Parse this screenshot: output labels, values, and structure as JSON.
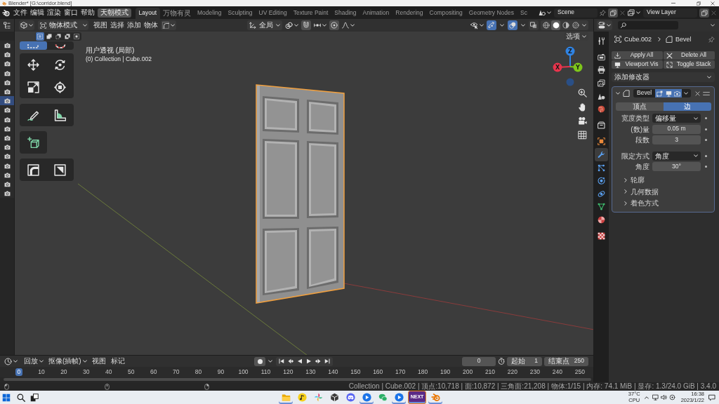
{
  "window": {
    "title": "Blender* [G:\\corridor.blend]"
  },
  "topbar": {
    "menus": [
      "文件",
      "编辑",
      "渲染",
      "窗口",
      "帮助"
    ],
    "mode_button": "天朝模式",
    "workspaces": [
      {
        "label": "Layout",
        "selected": true
      },
      {
        "label": "万物有灵",
        "selected": false
      },
      {
        "label": "Modeling",
        "selected": false
      },
      {
        "label": "Sculpting",
        "selected": false
      },
      {
        "label": "UV Editing",
        "selected": false
      },
      {
        "label": "Texture Paint",
        "selected": false
      },
      {
        "label": "Shading",
        "selected": false
      },
      {
        "label": "Animation",
        "selected": false
      },
      {
        "label": "Rendering",
        "selected": false
      },
      {
        "label": "Compositing",
        "selected": false
      },
      {
        "label": "Geometry Nodes",
        "selected": false
      },
      {
        "label": "Sc",
        "selected": false
      }
    ],
    "scene": "Scene",
    "view_layer": "View Layer"
  },
  "outliner": {
    "rows": [
      {
        "selected": false
      },
      {
        "selected": false
      },
      {
        "selected": false
      },
      {
        "selected": false
      },
      {
        "selected": false
      },
      {
        "selected": false
      },
      {
        "selected": true
      },
      {
        "selected": false
      },
      {
        "selected": false
      },
      {
        "selected": false
      },
      {
        "selected": false
      },
      {
        "selected": false
      },
      {
        "selected": false
      },
      {
        "selected": false
      },
      {
        "selected": false
      },
      {
        "selected": false
      },
      {
        "selected": false
      }
    ]
  },
  "viewport": {
    "mode": "物体模式",
    "menus": [
      "视图",
      "选择",
      "添加",
      "物体"
    ],
    "orientation": "全局",
    "toggles": [
      {
        "kind": "gizmo",
        "on": true
      },
      {
        "kind": "overlay",
        "on": true
      },
      {
        "kind": "xray",
        "on": false
      }
    ],
    "shading": [
      {
        "kind": "wireframe",
        "selected": false
      },
      {
        "kind": "solid",
        "selected": true
      },
      {
        "kind": "material",
        "selected": false
      },
      {
        "kind": "rendered",
        "selected": false
      }
    ],
    "options": "选项",
    "select_modes": [
      {
        "kind": "set",
        "selected": true
      },
      {
        "kind": "extend",
        "selected": false
      },
      {
        "kind": "subtract",
        "selected": false
      },
      {
        "kind": "difference",
        "selected": false
      },
      {
        "kind": "intersect",
        "selected": false
      }
    ],
    "tool_groups": [
      {
        "tools": [
          {
            "kind": "select",
            "selected": true
          },
          {
            "kind": "cursor",
            "selected": false
          }
        ]
      },
      {
        "tools": [
          {
            "kind": "move",
            "selected": false
          },
          {
            "kind": "rotate",
            "selected": false
          },
          {
            "kind": "scale",
            "selected": false
          },
          {
            "kind": "transform",
            "selected": false
          }
        ]
      },
      {
        "tools": [
          {
            "kind": "annotate",
            "selected": false
          },
          {
            "kind": "measure",
            "selected": false
          }
        ]
      },
      {
        "tools": [
          {
            "kind": "add_cube",
            "selected": false
          }
        ]
      },
      {
        "tools": [
          {
            "kind": "fillet",
            "selected": false
          },
          {
            "kind": "shear",
            "selected": false
          }
        ]
      }
    ],
    "view_name": "用户透视 (局部)",
    "info": "(0) Collection | Cube.002",
    "axes": [
      {
        "kind": "positive",
        "label": "Z",
        "color": "#2f83e3"
      },
      {
        "kind": "positive",
        "label": "X",
        "color": "#e8344c"
      },
      {
        "kind": "positive",
        "label": "Y",
        "color": "#7ec61b"
      },
      {
        "kind": "negative",
        "color": "#2a4f86"
      }
    ]
  },
  "properties": {
    "tab_groups": [
      {
        "tabs": [
          {
            "kind": "tool",
            "selected": false
          }
        ]
      },
      {
        "tabs": [
          {
            "kind": "render",
            "selected": false
          },
          {
            "kind": "output",
            "selected": false
          },
          {
            "kind": "view_layer",
            "selected": false
          },
          {
            "kind": "scene",
            "selected": false
          },
          {
            "kind": "world",
            "selected": false
          }
        ]
      },
      {
        "tabs": [
          {
            "kind": "collection",
            "selected": false
          }
        ]
      },
      {
        "tabs": [
          {
            "kind": "object",
            "selected": false
          },
          {
            "kind": "modifier",
            "selected": true
          },
          {
            "kind": "particles",
            "selected": false
          },
          {
            "kind": "physics",
            "selected": false
          },
          {
            "kind": "constraints",
            "selected": false
          },
          {
            "kind": "data",
            "selected": false
          },
          {
            "kind": "material",
            "selected": false
          }
        ]
      },
      {
        "tabs": [
          {
            "kind": "texture",
            "selected": false
          }
        ]
      }
    ],
    "breadcrumb": [
      {
        "kind": "object",
        "label": "Cube.002"
      },
      {
        "kind": "modifier",
        "label": "Bevel"
      }
    ],
    "actions": [
      {
        "kind": "apply",
        "label": "Apply All"
      },
      {
        "kind": "delete",
        "label": "Delete All"
      },
      {
        "kind": "visibility",
        "label": "Viewport Vis"
      },
      {
        "kind": "stack",
        "label": "Toggle Stack"
      }
    ],
    "add_modifier": "添加修改器",
    "modifier": {
      "name": "Bevel",
      "expanded": true,
      "toggles": [
        {
          "kind": "edit_mode",
          "on": true
        },
        {
          "kind": "viewport",
          "on": true
        },
        {
          "kind": "render",
          "on": true
        }
      ],
      "affect": [
        {
          "label": "顶点",
          "selected": false
        },
        {
          "label": "边",
          "selected": true
        }
      ],
      "field_groups": [
        {
          "fields": [
            {
              "kind": "dropdown",
              "label": "宽度类型",
              "value": "偏移量"
            },
            {
              "kind": "number",
              "label": "(数)量",
              "value": "0.05 m"
            },
            {
              "kind": "number",
              "label": "段数",
              "value": "3"
            }
          ]
        },
        {
          "fields": [
            {
              "kind": "dropdown",
              "label": "限定方式",
              "value": "角度"
            },
            {
              "kind": "number",
              "label": "角度",
              "value": "30°"
            }
          ]
        }
      ],
      "subpanels": [
        {
          "label": "轮廓",
          "expanded": false
        },
        {
          "label": "几何数据",
          "expanded": false
        },
        {
          "label": "着色方式",
          "expanded": false
        }
      ]
    }
  },
  "timeline": {
    "menus": [
      {
        "kind": "dropdown",
        "label": "回放"
      },
      {
        "kind": "dropdown",
        "label": "抠像(插帧)"
      },
      {
        "kind": "plain",
        "label": "视图"
      },
      {
        "kind": "plain",
        "label": "标记"
      }
    ],
    "frame": "0",
    "start_label": "起始",
    "start": "1",
    "end_label": "结束点",
    "end": "250",
    "ruler": [
      {
        "label": "0",
        "current": true
      },
      {
        "label": "10",
        "current": false
      },
      {
        "label": "20",
        "current": false
      },
      {
        "label": "30",
        "current": false
      },
      {
        "label": "40",
        "current": false
      },
      {
        "label": "50",
        "current": false
      },
      {
        "label": "60",
        "current": false
      },
      {
        "label": "70",
        "current": false
      },
      {
        "label": "80",
        "current": false
      },
      {
        "label": "90",
        "current": false
      },
      {
        "label": "100",
        "current": false
      },
      {
        "label": "110",
        "current": false
      },
      {
        "label": "120",
        "current": false
      },
      {
        "label": "130",
        "current": false
      },
      {
        "label": "140",
        "current": false
      },
      {
        "label": "150",
        "current": false
      },
      {
        "label": "160",
        "current": false
      },
      {
        "label": "170",
        "current": false
      },
      {
        "label": "180",
        "current": false
      },
      {
        "label": "190",
        "current": false
      },
      {
        "label": "200",
        "current": false
      },
      {
        "label": "210",
        "current": false
      },
      {
        "label": "220",
        "current": false
      },
      {
        "label": "230",
        "current": false
      },
      {
        "label": "240",
        "current": false
      },
      {
        "label": "250",
        "current": false
      }
    ]
  },
  "status_bar": {
    "text": "Collection | Cube.002 | 顶点:10,718 | 面:10,872 | 三角面:21,208 | 物体:1/15 | 内存: 74.1 MiB | 显存: 1.3/24.0 GiB | 3.4.0"
  },
  "taskbar": {
    "apps": [
      {
        "kind": "folder",
        "running": true
      },
      {
        "kind": "music",
        "running": false
      },
      {
        "kind": "pinwheel",
        "running": false
      },
      {
        "kind": "cube",
        "running": false
      },
      {
        "kind": "controller",
        "running": false
      },
      {
        "kind": "play_circle",
        "running": true
      },
      {
        "kind": "chat",
        "running": false
      },
      {
        "kind": "play_circle",
        "running": true
      },
      {
        "kind": "tile",
        "label": "NEXT",
        "running": true
      },
      {
        "kind": "logo",
        "running": true
      }
    ],
    "temperature": "37°C",
    "sensor": "CPU",
    "time": "16:38",
    "date": "2023/1/22"
  }
}
